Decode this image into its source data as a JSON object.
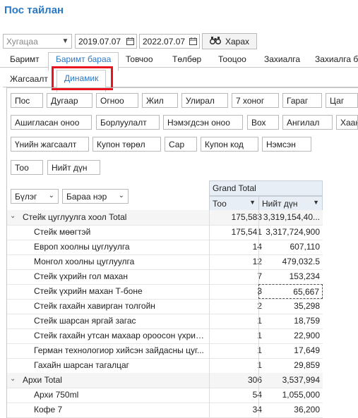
{
  "app": {
    "title": "Пос тайлан"
  },
  "filters": {
    "period_placeholder": "Хугацаа",
    "date_from": "2019.07.07",
    "date_to": "2022.07.07",
    "search_label": "Харах"
  },
  "main_tabs": [
    "Баримт",
    "Баримт бараа",
    "Товчоо",
    "Төлбөр",
    "Тооцоо",
    "Захиалга",
    "Захиалга ба"
  ],
  "main_tab_active": "Баримт бараа",
  "sub_tabs": [
    "Жагсаалт",
    "Динамик"
  ],
  "sub_tab_active": "Динамик",
  "field_chips": [
    "Пос",
    "Дугаар",
    "Огноо",
    "Жил",
    "Улирал",
    "7 хоног",
    "Гараг",
    "Цаг",
    "Ашигласан оноо",
    "Борлуулалт",
    "Нэмэгдсэн оноо",
    "Вох",
    "Ангилал",
    "Хаан",
    "Үнийн жагсаалт",
    "Купон төрөл",
    "Сар",
    "Купон код",
    "Нэмсэн",
    "Тоо",
    "Нийт дүн"
  ],
  "row_fields": [
    "Бүлэг",
    "Бараа нэр"
  ],
  "grid": {
    "grand_total_label": "Grand Total",
    "col_qty": "Тоо",
    "col_amount": "Нийт дүн",
    "rows": [
      {
        "label": "Стейк цуглуулга хоол Total",
        "qty": "175,583",
        "amount": "3,319,154,40...",
        "total": true
      },
      {
        "label": "Стейк мөөгтэй",
        "qty": "175,541",
        "amount": "3,317,724,900"
      },
      {
        "label": "Европ хоолны цуглуулга",
        "qty": "14",
        "amount": "607,110"
      },
      {
        "label": "Монгол хоолны цуглуулга",
        "qty": "12",
        "amount": "479,032.5"
      },
      {
        "label": "Стейк үхрийн гол махан",
        "qty": "7",
        "amount": "153,234"
      },
      {
        "label": "Стейк үхрийн махан Т-боне",
        "qty": "3",
        "amount": "65,667"
      },
      {
        "label": "Стейк гахайн хавирган толгойн",
        "qty": "2",
        "amount": "35,298"
      },
      {
        "label": "Стейк шарсан яргай загас",
        "qty": "1",
        "amount": "18,759"
      },
      {
        "label": "Стейк гахайн утсан махаар ороосон үхрийн...",
        "qty": "1",
        "amount": "22,900"
      },
      {
        "label": "Герман технологиор хийсэн зайдасны цуг...",
        "qty": "1",
        "amount": "17,649"
      },
      {
        "label": "Гахайн шарсан тагалцаг",
        "qty": "1",
        "amount": "29,859"
      },
      {
        "label": "Архи Total",
        "qty": "306",
        "amount": "3,537,994",
        "total": true
      },
      {
        "label": "Архи 750ml",
        "qty": "54",
        "amount": "1,055,000"
      },
      {
        "label": "Кофе 7",
        "qty": "34",
        "amount": "36,200"
      }
    ]
  }
}
